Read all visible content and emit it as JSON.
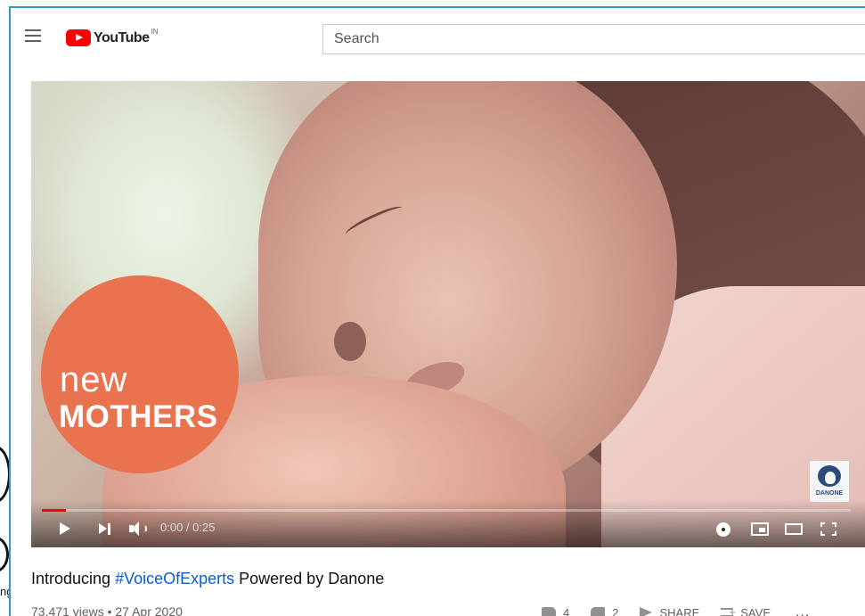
{
  "page_edge": {
    "text": "ng"
  },
  "masthead": {
    "logo_text": "YouTube",
    "logo_country": "IN",
    "search_placeholder": "Search"
  },
  "player": {
    "overlay_line1": "new",
    "overlay_line2": "MOTHERS",
    "watermark": "DANONE",
    "time": "0:00 / 0:25",
    "progress_fraction": 0.03
  },
  "video": {
    "title_prefix": "Introducing ",
    "title_hashtag": "#VoiceOfExperts",
    "title_suffix": " Powered by Danone",
    "meta": "73,471 views • 27 Apr 2020"
  },
  "actions": {
    "likes": "4",
    "dislikes": "2",
    "share_label": "SHARE",
    "save_label": "SAVE",
    "more_label": "..."
  },
  "colors": {
    "accent": "#ff0000",
    "link": "#065fd4",
    "badge": "#e9734e",
    "window_border": "#2f9cc4"
  },
  "icons": [
    "menu-icon",
    "youtube-logo-icon",
    "play-icon",
    "next-icon",
    "volume-icon",
    "settings-gear-icon",
    "miniplayer-icon",
    "theater-mode-icon",
    "fullscreen-icon",
    "thumbs-up-icon",
    "thumbs-down-icon",
    "share-arrow-icon",
    "save-playlist-icon",
    "more-icon",
    "danone-logo-icon"
  ]
}
